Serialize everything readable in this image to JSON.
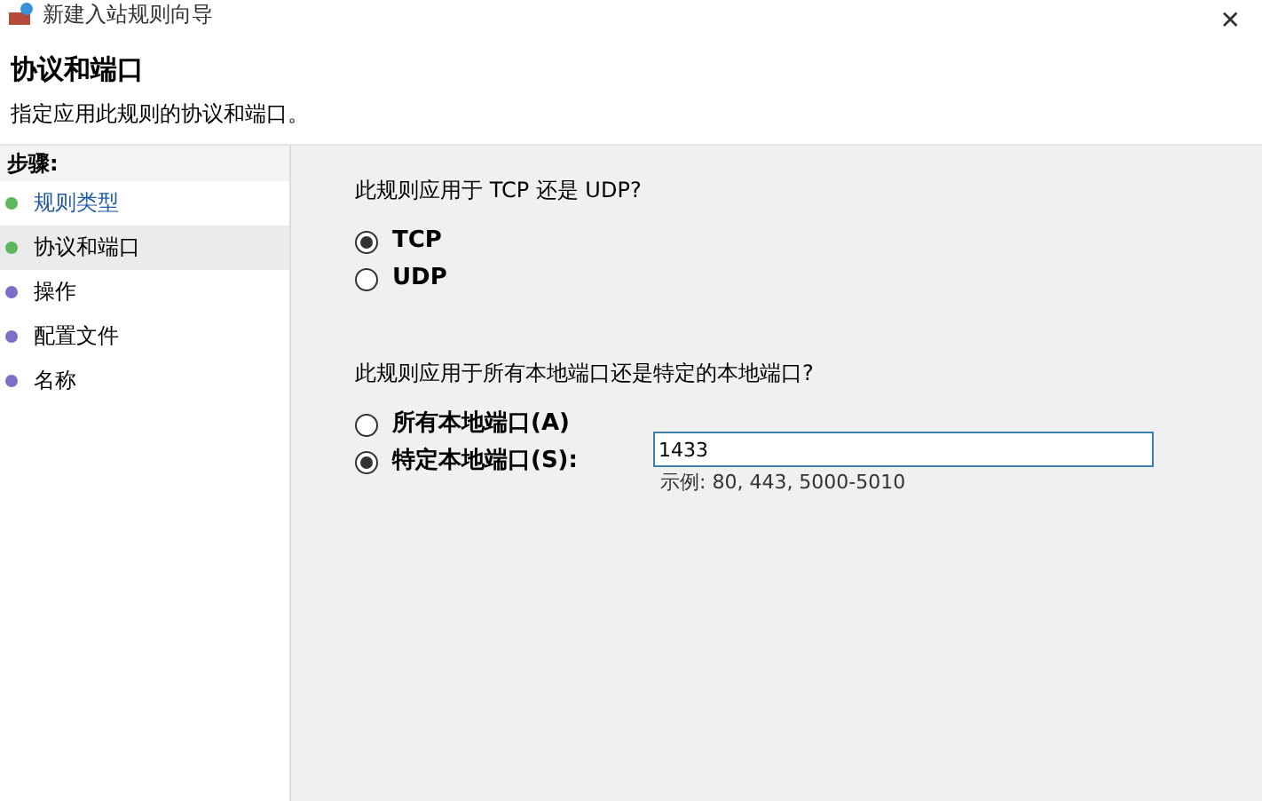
{
  "window": {
    "title": "新建入站规则向导",
    "close": "✕"
  },
  "header": {
    "title": "协议和端口",
    "subtitle": "指定应用此规则的协议和端口。"
  },
  "steps": {
    "heading": "步骤:",
    "items": [
      {
        "label": "规则类型",
        "color": "#5cb85c",
        "selected": false,
        "kind": "link"
      },
      {
        "label": "协议和端口",
        "color": "#5cb85c",
        "selected": true,
        "kind": "text"
      },
      {
        "label": "操作",
        "color": "#7b6fc8",
        "selected": false,
        "kind": "text"
      },
      {
        "label": "配置文件",
        "color": "#7b6fc8",
        "selected": false,
        "kind": "text"
      },
      {
        "label": "名称",
        "color": "#7b6fc8",
        "selected": false,
        "kind": "text"
      }
    ]
  },
  "protocol": {
    "question": "此规则应用于 TCP 还是 UDP?",
    "options": [
      {
        "label": "TCP",
        "selected": true
      },
      {
        "label": "UDP",
        "selected": false
      }
    ]
  },
  "ports": {
    "question": "此规则应用于所有本地端口还是特定的本地端口?",
    "options": [
      {
        "label": "所有本地端口(A)",
        "selected": false
      },
      {
        "label": "特定本地端口(S):",
        "selected": true
      }
    ],
    "value": "1433",
    "example": "示例: 80, 443, 5000-5010"
  }
}
